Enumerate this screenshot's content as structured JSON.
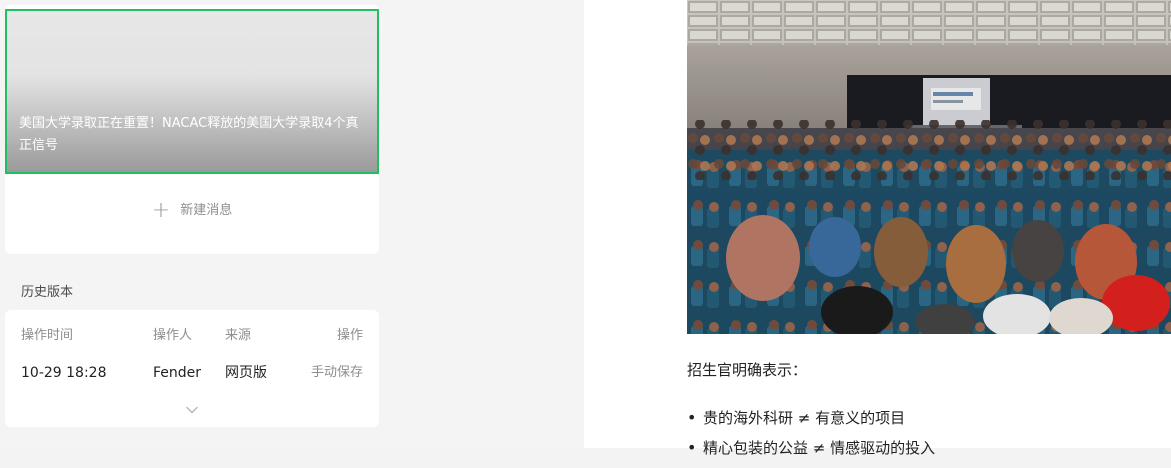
{
  "editor": {
    "article_card": {
      "cover_title": "美国大学录取正在重置！NACAC释放的美国大学录取4个真正信号",
      "new_message_label": "新建消息"
    },
    "history": {
      "title": "历史版本",
      "columns": [
        "操作时间",
        "操作人",
        "来源",
        "操作"
      ],
      "rows": [
        {
          "time": "10-29 18:28",
          "operator": "Fender",
          "source": "网页版",
          "action": "手动保存"
        }
      ]
    }
  },
  "preview": {
    "lead_text": "招生官明确表示：",
    "bullets": [
      "贵的海外科研 ≠ 有意义的项目",
      "精心包装的公益 ≠ 情感驱动的投入"
    ]
  },
  "colors": {
    "accent_border": "#1ec15f",
    "left_background": "#f4f4f4",
    "card_background": "#ffffff",
    "muted_text": "#8d8d8d"
  },
  "icons": {
    "new_message": "plus-icon",
    "expand": "chevron-down-icon"
  }
}
